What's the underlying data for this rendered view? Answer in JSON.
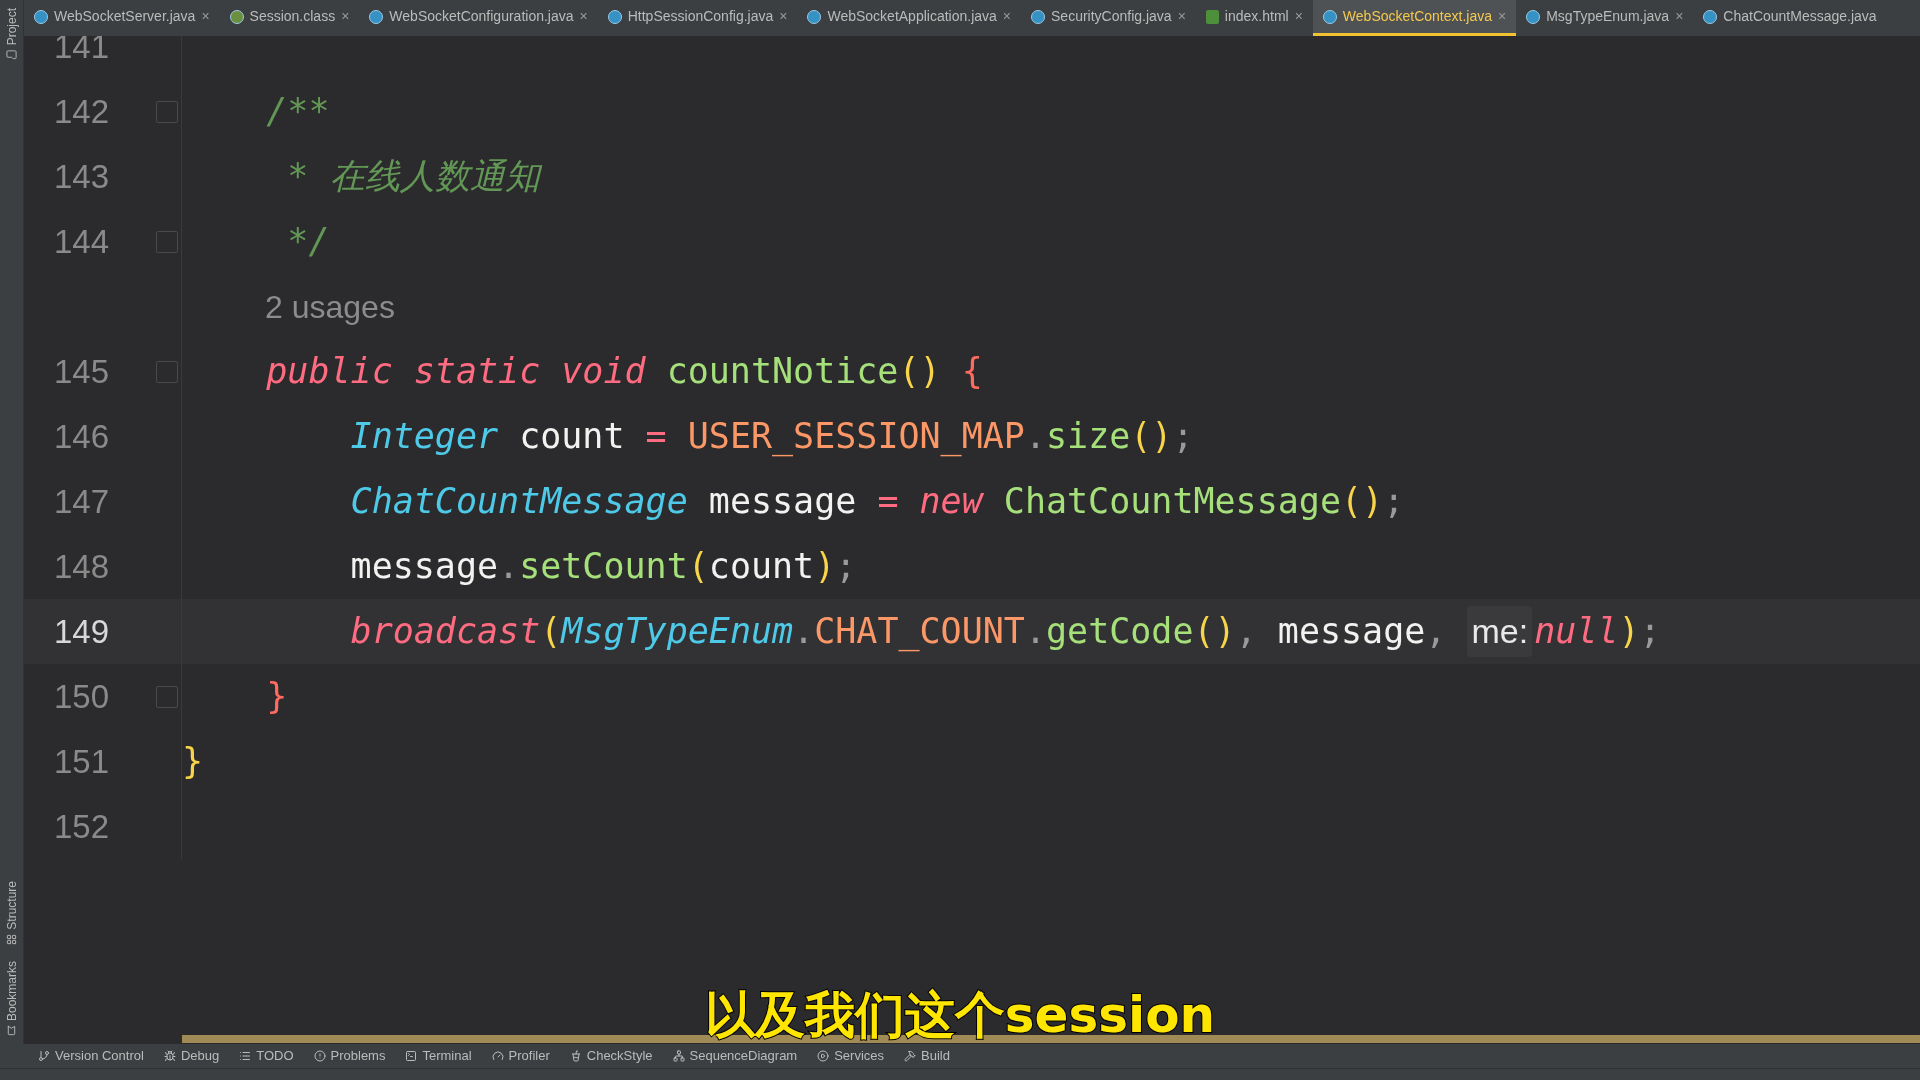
{
  "tabs": [
    {
      "label": "WebSocketServer.java",
      "kind": "class",
      "close": "×",
      "selected": false
    },
    {
      "label": "Session.class",
      "kind": "interface",
      "close": "×",
      "selected": false
    },
    {
      "label": "WebSocketConfiguration.java",
      "kind": "class",
      "close": "×",
      "selected": false
    },
    {
      "label": "HttpSessionConfig.java",
      "kind": "class",
      "close": "×",
      "selected": false
    },
    {
      "label": "WebSocketApplication.java",
      "kind": "app",
      "close": "×",
      "selected": false
    },
    {
      "label": "SecurityConfig.java",
      "kind": "class",
      "close": "×",
      "selected": false
    },
    {
      "label": "index.html",
      "kind": "html",
      "close": "×",
      "selected": false
    },
    {
      "label": "WebSocketContext.java",
      "kind": "class",
      "close": "×",
      "selected": true
    },
    {
      "label": "MsgTypeEnum.java",
      "kind": "enum",
      "close": "×",
      "selected": false
    },
    {
      "label": "ChatCountMessage.java",
      "kind": "class",
      "selected": false
    }
  ],
  "side_panels": [
    {
      "label": "Project"
    },
    {
      "label": "Structure"
    },
    {
      "label": "Bookmarks"
    }
  ],
  "lines": [
    {
      "kind": "code",
      "number": "141",
      "current": false,
      "fold": false
    },
    {
      "kind": "code",
      "number": "142",
      "current": false,
      "fold": true,
      "tokens": [
        {
          "kind": "comment",
          "text": "    /**"
        }
      ]
    },
    {
      "kind": "code",
      "number": "143",
      "current": false,
      "fold": false,
      "tokens": [
        {
          "kind": "comment",
          "text": "     * 在线人数通知"
        }
      ]
    },
    {
      "kind": "code",
      "number": "144",
      "current": false,
      "fold": true,
      "tokens": [
        {
          "kind": "comment",
          "text": "     */"
        }
      ]
    },
    {
      "kind": "inlay",
      "text": "2 usages"
    },
    {
      "kind": "code",
      "number": "145",
      "current": false,
      "fold": true,
      "tokens": [
        {
          "kind": "keyword",
          "text": "    public static void "
        },
        {
          "kind": "function",
          "text": "countNotice"
        },
        {
          "kind": "paren",
          "text": "() "
        },
        {
          "kind": "brace",
          "text": "{"
        }
      ]
    },
    {
      "kind": "code",
      "number": "146",
      "current": false,
      "fold": false,
      "tokens": [
        {
          "kind": "type",
          "text": "        Integer"
        },
        {
          "kind": "plain",
          "text": " count "
        },
        {
          "kind": "keyword",
          "text": "= "
        },
        {
          "kind": "constant",
          "text": "USER_SESSION_MAP"
        },
        {
          "kind": "punct",
          "text": "."
        },
        {
          "kind": "function",
          "text": "size"
        },
        {
          "kind": "paren",
          "text": "()"
        },
        {
          "kind": "punct",
          "text": ";"
        }
      ]
    },
    {
      "kind": "code",
      "number": "147",
      "current": false,
      "fold": false,
      "tokens": [
        {
          "kind": "type",
          "text": "        ChatCountMessage"
        },
        {
          "kind": "plain",
          "text": " message "
        },
        {
          "kind": "keyword",
          "text": "= new "
        },
        {
          "kind": "function",
          "text": "ChatCountMessage"
        },
        {
          "kind": "paren",
          "text": "()"
        },
        {
          "kind": "punct",
          "text": ";"
        }
      ]
    },
    {
      "kind": "code",
      "number": "148",
      "current": false,
      "fold": false,
      "tokens": [
        {
          "kind": "plain",
          "text": "        message"
        },
        {
          "kind": "punct",
          "text": "."
        },
        {
          "kind": "function",
          "text": "setCount"
        },
        {
          "kind": "paren",
          "text": "("
        },
        {
          "kind": "plain",
          "text": "count"
        },
        {
          "kind": "paren",
          "text": ")"
        },
        {
          "kind": "punct",
          "text": ";"
        }
      ]
    },
    {
      "kind": "code",
      "number": "149",
      "current": true,
      "fold": false,
      "tokens": [
        {
          "kind": "keyword",
          "text": "        broadcast"
        },
        {
          "kind": "paren",
          "text": "("
        },
        {
          "kind": "type",
          "text": "MsgTypeEnum"
        },
        {
          "kind": "punct",
          "text": "."
        },
        {
          "kind": "constant",
          "text": "CHAT_COUNT"
        },
        {
          "kind": "punct",
          "text": "."
        },
        {
          "kind": "function",
          "text": "getCode"
        },
        {
          "kind": "paren",
          "text": "()"
        },
        {
          "kind": "punct",
          "text": ","
        },
        {
          "kind": "plain",
          "text": " message"
        },
        {
          "kind": "punct",
          "text": ", "
        },
        {
          "kind": "hint",
          "text": "me:"
        },
        {
          "kind": "keyword",
          "text": "null"
        },
        {
          "kind": "paren",
          "text": ")"
        },
        {
          "kind": "punct",
          "text": ";"
        }
      ]
    },
    {
      "kind": "code",
      "number": "150",
      "current": false,
      "fold": true,
      "tokens": [
        {
          "kind": "brace",
          "text": "    }"
        }
      ]
    },
    {
      "kind": "code",
      "number": "151",
      "current": false,
      "fold": false,
      "tokens": [
        {
          "kind": "paren",
          "text": "}"
        }
      ]
    },
    {
      "kind": "code",
      "number": "152",
      "current": false,
      "fold": false
    }
  ],
  "tool_windows": [
    {
      "label": "Version Control",
      "kind": "branch"
    },
    {
      "label": "Debug",
      "kind": "bug"
    },
    {
      "label": "TODO",
      "kind": "list"
    },
    {
      "label": "Problems",
      "kind": "alert"
    },
    {
      "label": "Terminal",
      "kind": "terminal"
    },
    {
      "label": "Profiler",
      "kind": "gauge"
    },
    {
      "label": "CheckStyle",
      "kind": "cup"
    },
    {
      "label": "SequenceDiagram",
      "kind": "diagram"
    },
    {
      "label": "Services",
      "kind": "play"
    },
    {
      "label": "Build",
      "kind": "hammer"
    }
  ],
  "subtitle": "以及我们这个session"
}
